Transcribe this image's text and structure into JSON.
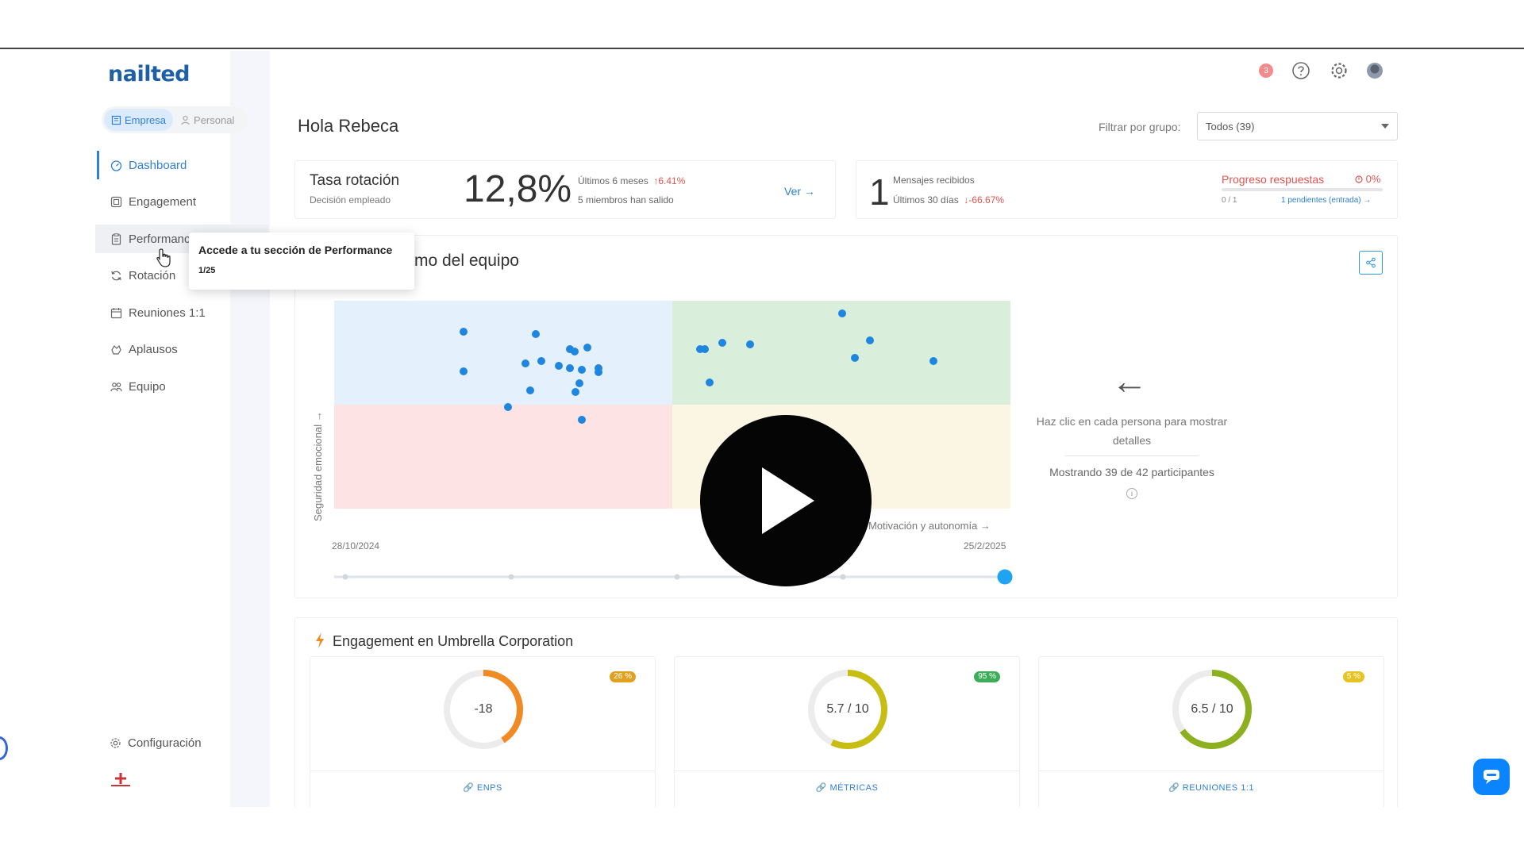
{
  "brand": {
    "logo": "nailted",
    "accent": "#2f7fd4"
  },
  "mode_switch": {
    "company": "Empresa",
    "personal": "Personal"
  },
  "nav": {
    "dashboard": "Dashboard",
    "engagement": "Engagement",
    "performance": "Performanc",
    "rotation": "Rotación",
    "meetings": "Reuniones 1:1",
    "applause": "Aplausos",
    "team": "Equipo",
    "config": "Configuración"
  },
  "header": {
    "notifications": "3",
    "greeting": "Hola Rebeca",
    "filter_label": "Filtrar por grupo:",
    "filter_value": "Todos (39)"
  },
  "rotation_card": {
    "title": "Tasa rotación",
    "subtitle": "Decisión empleado",
    "value": "12,8%",
    "period": "Últimos 6 meses",
    "change": "↑6.41%",
    "members_left": "5 miembros han salido",
    "link": "Ver →"
  },
  "messages_card": {
    "count": "1",
    "label": "Mensajes recibidos",
    "period": "Últimos 30 días",
    "change": "↓-66.67%",
    "progress_title": "Progreso respuestas",
    "progress_pct": "0%",
    "progress_fraction": 0,
    "progress_count": "0 / 1",
    "pending": "1 pendientes (entrada) →"
  },
  "team_climate": {
    "title": "mo del equipo",
    "y_label": "Seguridad emocional →",
    "x_label": "Motivación y autonomía →",
    "date_start": "28/10/2024",
    "date_end": "25/2/2025",
    "hint": "Haz clic en cada persona para mostrar detalles",
    "showing": "Mostrando 39 de 42 participantes",
    "quadrant_colors": [
      "#e4f1fc",
      "#d9eedb",
      "#fde3e3",
      "#fbf6e4"
    ],
    "point_color": "#1f86e0"
  },
  "engagement": {
    "title": "Engagement en Umbrella Corporation",
    "metrics": [
      {
        "value": "-18",
        "badge": "26 %",
        "badge_color": "#e0a020",
        "ring_color": "#f08a24",
        "fill": 0.41,
        "link": "ENPS"
      },
      {
        "value": "5.7 / 10",
        "badge": "95 %",
        "badge_color": "#3cae5a",
        "ring_color": "#c8bd12",
        "fill": 0.57,
        "link": "MÉTRICAS"
      },
      {
        "value": "6.5 / 10",
        "badge": "5 %",
        "badge_color": "#e6c320",
        "ring_color": "#8cb020",
        "fill": 0.65,
        "link": "REUNIONES 1:1"
      }
    ]
  },
  "tooltip": {
    "title": "Accede a tu sección de Performance",
    "step": "1/25"
  }
}
